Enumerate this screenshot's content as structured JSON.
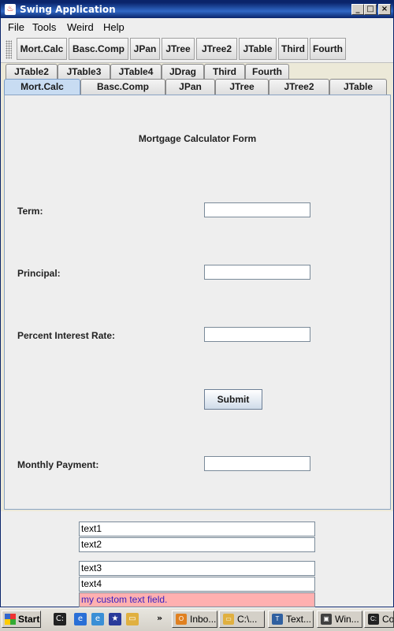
{
  "window": {
    "title": "Swing Application"
  },
  "menubar": {
    "items": [
      "File",
      "Tools",
      "Weird",
      "Help"
    ]
  },
  "toolbar": {
    "buttons": [
      "Mort.Calc",
      "Basc.Comp",
      "JPan",
      "JTree",
      "JTree2",
      "JTable",
      "Third",
      "Fourth"
    ]
  },
  "tabs": {
    "row_back": [
      "JTable2",
      "JTable3",
      "JTable4",
      "JDrag",
      "Third",
      "Fourth"
    ],
    "row_front": [
      "Mort.Calc",
      "Basc.Comp",
      "JPan",
      "JTree",
      "JTree2",
      "JTable"
    ],
    "selected": "Mort.Calc"
  },
  "form": {
    "title": "Mortgage Calculator Form",
    "term_label": "Term:",
    "term_value": "",
    "principal_label": "Principal:",
    "principal_value": "",
    "rate_label": "Percent Interest Rate:",
    "rate_value": "",
    "submit_label": "Submit",
    "payment_label": "Monthly Payment:",
    "payment_value": ""
  },
  "text_fields": [
    "text1",
    "text2",
    "text3",
    "text4"
  ],
  "custom_field": {
    "value": "my custom text field.",
    "background": "#ffb0b0",
    "color": "#3b20c0"
  },
  "taskbar": {
    "start_label": "Start",
    "overflow": "»",
    "tasks": [
      "Inbo...",
      "C:\\...",
      "Text...",
      "Win...",
      "Co"
    ]
  },
  "colors": {
    "titlebar": "#0a246a",
    "selected_tab": "#c8dcf2",
    "panel_border": "#8aa4c4"
  }
}
